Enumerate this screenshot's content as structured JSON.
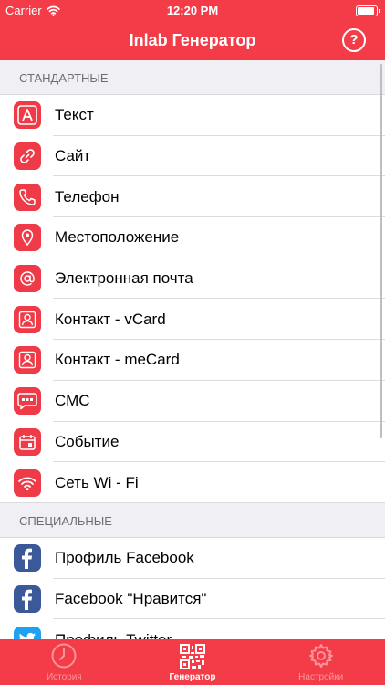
{
  "status": {
    "carrier": "Carrier",
    "time": "12:20 PM"
  },
  "nav": {
    "title": "Inlab Генератор",
    "help": "?"
  },
  "sections": {
    "standard": {
      "header": "СТАНДАРТНЫЕ",
      "items": [
        {
          "label": "Текст",
          "icon": "text-a-icon"
        },
        {
          "label": "Сайт",
          "icon": "link-icon"
        },
        {
          "label": "Телефон",
          "icon": "phone-icon"
        },
        {
          "label": "Местоположение",
          "icon": "location-pin-icon"
        },
        {
          "label": "Электронная почта",
          "icon": "at-sign-icon"
        },
        {
          "label": "Контакт - vCard",
          "icon": "contact-person-icon"
        },
        {
          "label": "Контакт - meCard",
          "icon": "contact-person-icon"
        },
        {
          "label": "СМС",
          "icon": "message-bubble-icon"
        },
        {
          "label": "Событие",
          "icon": "calendar-icon"
        },
        {
          "label": "Сеть Wi - Fi",
          "icon": "wifi-icon"
        }
      ]
    },
    "special": {
      "header": "СПЕЦИАЛЬНЫЕ",
      "items": [
        {
          "label": "Профиль Facebook",
          "icon": "facebook-icon"
        },
        {
          "label": "Facebook \"Нравится\"",
          "icon": "facebook-icon"
        },
        {
          "label": "Профиль Twitter",
          "icon": "twitter-icon"
        }
      ]
    }
  },
  "tabs": [
    {
      "label": "История",
      "icon": "clock-icon",
      "active": false
    },
    {
      "label": "Генератор",
      "icon": "qr-code-icon",
      "active": true
    },
    {
      "label": "Настройки",
      "icon": "gear-icon",
      "active": false
    }
  ],
  "colors": {
    "accent": "#f33c48",
    "icon_red": "#ef3a47",
    "facebook": "#3b5998",
    "twitter": "#1da1f2"
  }
}
